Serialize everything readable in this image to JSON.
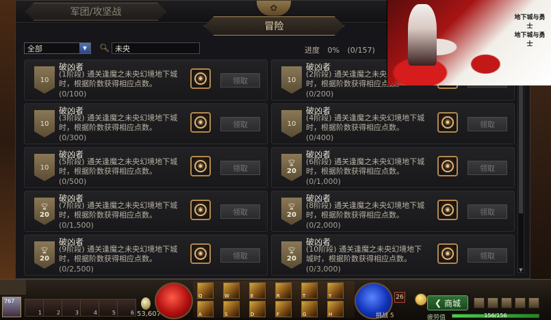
{
  "top": {
    "guild_tab": "军团/攻坚战",
    "adventure_tab": "冒险"
  },
  "filter": {
    "category_value": "全部",
    "search_value": "未央"
  },
  "progress": {
    "label": "进度",
    "percent": "0%",
    "count": "(0/157)"
  },
  "claim_label": "领取",
  "quests": [
    {
      "title": "破凶者",
      "desc": "(1阶段) 通关逢魔之未央幻境地下城时，根据阶数获得相应点数。",
      "count": "(0/100)",
      "badge": "10",
      "trophy": false
    },
    {
      "title": "破凶者",
      "desc": "(2阶段) 通关逢魔之未央幻境地下城时，根据阶数获得相应点数。",
      "count": "(0/200)",
      "badge": "10",
      "trophy": false
    },
    {
      "title": "破凶者",
      "desc": "(3阶段) 通关逢魔之未央幻境地下城时，根据阶数获得相应点数。",
      "count": "(0/300)",
      "badge": "10",
      "trophy": false
    },
    {
      "title": "破凶者",
      "desc": "(4阶段) 通关逢魔之未央幻境地下城时，根据阶数获得相应点数。",
      "count": "(0/400)",
      "badge": "10",
      "trophy": false
    },
    {
      "title": "破凶者",
      "desc": "(5阶段) 通关逢魔之未央幻境地下城时，根据阶数获得相应点数。",
      "count": "(0/500)",
      "badge": "10",
      "trophy": false
    },
    {
      "title": "破凶者",
      "desc": "(6阶段) 通关逢魔之未央幻境地下城时，根据阶数获得相应点数。",
      "count": "(0/1,000)",
      "badge": "20",
      "trophy": true
    },
    {
      "title": "破凶者",
      "desc": "(7阶段) 通关逢魔之未央幻境地下城时，根据阶数获得相应点数。",
      "count": "(0/1,500)",
      "badge": "20",
      "trophy": true
    },
    {
      "title": "破凶者",
      "desc": "(8阶段) 通关逢魔之未央幻境地下城时，根据阶数获得相应点数。",
      "count": "(0/2,000)",
      "badge": "20",
      "trophy": true
    },
    {
      "title": "破凶者",
      "desc": "(9阶段) 通关逢魔之未央幻境地下城时，根据阶数获得相应点数。",
      "count": "(0/2,500)",
      "badge": "20",
      "trophy": true
    },
    {
      "title": "破凶者",
      "desc": "(10阶段) 通关逢魔之未央幻境地下城时，根据阶数获得相应点数。",
      "count": "(0/3,000)",
      "badge": "20",
      "trophy": true
    }
  ],
  "banner": {
    "logo_text": "地下城与勇士"
  },
  "hud": {
    "level": "767",
    "gold": "53,607",
    "fatigue_label": "挑战",
    "fatigue_value": "5",
    "level_badge": "26",
    "shop_label": "商城",
    "fatigue_text": "疲劳值",
    "fatigue_bar_text": "156/156",
    "fatigue_fraction": 1.0,
    "slot_keys": [
      "1",
      "2",
      "3",
      "4",
      "5",
      "6"
    ],
    "skill_keys": [
      "Q",
      "W",
      "E",
      "R",
      "T",
      "Y",
      "A",
      "S",
      "D",
      "F",
      "G",
      "H"
    ]
  }
}
